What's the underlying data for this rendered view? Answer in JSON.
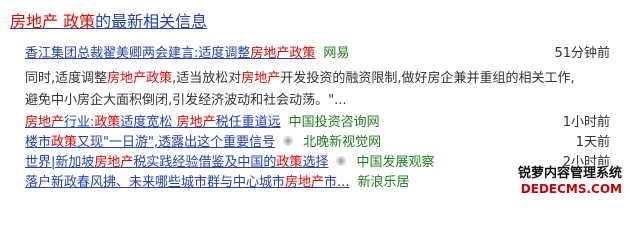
{
  "headline": {
    "part1": "房地产",
    "sep": " ",
    "part2": "政策",
    "part3": "的最新相关信息"
  },
  "top_item": {
    "title_pre": "香江集团总裁翟美卿两会建言:适度调整",
    "title_hl": "房地产政策",
    "source": "网易",
    "time": "51分钟前",
    "summary_1": "同时,适度调整",
    "summary_hl1": "房地产政策",
    "summary_2": ",适当放松对",
    "summary_hl2": "房地产",
    "summary_3": "开发投资的融资限制,做好房企兼并重组的相关工作,避免中小房企大面积倒闭,引发经济波动和社会动荡。\"..."
  },
  "list": [
    {
      "segments": [
        {
          "text": "房地产",
          "hl": true
        },
        {
          "text": "行业:",
          "hl": false
        },
        {
          "text": "政策",
          "hl": true
        },
        {
          "text": "适度宽松 ",
          "hl": false
        },
        {
          "text": "房地产",
          "hl": true
        },
        {
          "text": "税任重道远",
          "hl": false
        }
      ],
      "source": "中国投资咨询网",
      "time": "1小时前",
      "icon": false
    },
    {
      "segments": [
        {
          "text": "楼市",
          "hl": false
        },
        {
          "text": "政策",
          "hl": true
        },
        {
          "text": "又现\"一日游\",透露出这个重要信号",
          "hl": false
        }
      ],
      "source": "北晚新视觉网",
      "time": "1天前",
      "icon": true
    },
    {
      "segments": [
        {
          "text": "世界|新加坡",
          "hl": false
        },
        {
          "text": "房地产",
          "hl": true
        },
        {
          "text": "税实践经验借鉴及中国的",
          "hl": false
        },
        {
          "text": "政策",
          "hl": true
        },
        {
          "text": "选择",
          "hl": false
        }
      ],
      "source": "中国发展观察",
      "time": "2小时前",
      "icon": true
    },
    {
      "segments": [
        {
          "text": "落户新政春风拂、未来哪些城市群与中心城市",
          "hl": false
        },
        {
          "text": "房地产",
          "hl": true
        },
        {
          "text": "市...",
          "hl": false
        }
      ],
      "source": "新浪乐居",
      "time": "",
      "icon": false
    }
  ],
  "watermark": {
    "line1": "锐萝内容管理系统",
    "line2": "DEDECMS.COM"
  },
  "colors": {
    "link": "#2440b3",
    "highlight": "#e10602",
    "source": "#1e7d1e"
  }
}
